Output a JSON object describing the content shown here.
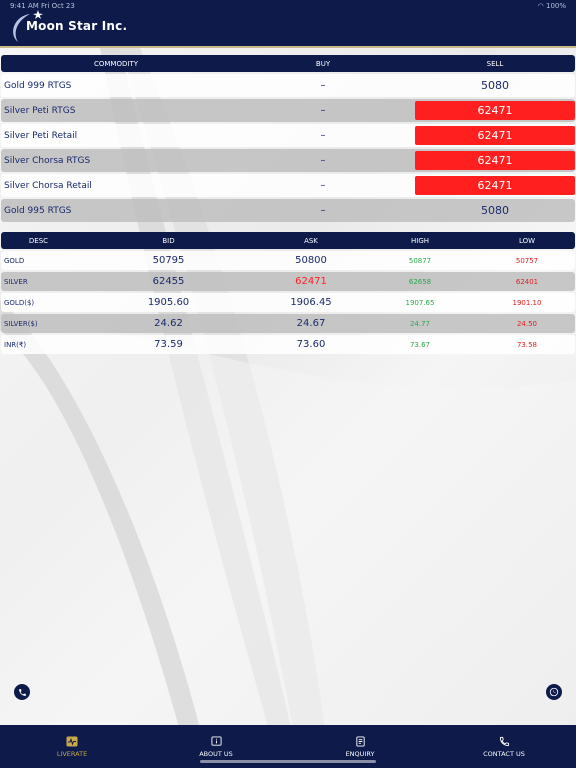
{
  "status": {
    "time": "9:41 AM",
    "date": "Fri Oct 23",
    "battery": "100%"
  },
  "brand": {
    "name": "Moon Star Inc."
  },
  "commodity_table": {
    "headers": {
      "commodity": "COMMODITY",
      "buy": "BUY",
      "sell": "SELL"
    },
    "rows": [
      {
        "name": "Gold 999 RTGS",
        "buy": "–",
        "sell": "5080",
        "highlight": false
      },
      {
        "name": "Silver Peti RTGS",
        "buy": "–",
        "sell": "62471",
        "highlight": true
      },
      {
        "name": "Silver Peti Retail",
        "buy": "–",
        "sell": "62471",
        "highlight": true
      },
      {
        "name": "Silver Chorsa RTGS",
        "buy": "–",
        "sell": "62471",
        "highlight": true
      },
      {
        "name": "Silver Chorsa Retail",
        "buy": "–",
        "sell": "62471",
        "highlight": true
      },
      {
        "name": "Gold 995 RTGS",
        "buy": "–",
        "sell": "5080",
        "highlight": false
      }
    ]
  },
  "rates_table": {
    "headers": {
      "desc": "DESC",
      "bid": "BID",
      "ask": "ASK",
      "high": "HIGH",
      "low": "LOW"
    },
    "rows": [
      {
        "desc": "GOLD",
        "bid": "50795",
        "ask": "50800",
        "high": "50877",
        "low": "50757",
        "ask_red": false
      },
      {
        "desc": "SILVER",
        "bid": "62455",
        "ask": "62471",
        "high": "62658",
        "low": "62401",
        "ask_red": true
      },
      {
        "desc": "GOLD($)",
        "bid": "1905.60",
        "ask": "1906.45",
        "high": "1907.65",
        "low": "1901.10",
        "ask_red": false
      },
      {
        "desc": "SILVER($)",
        "bid": "24.62",
        "ask": "24.67",
        "high": "24.77",
        "low": "24.50",
        "ask_red": false
      },
      {
        "desc": "INR(₹)",
        "bid": "73.59",
        "ask": "73.60",
        "high": "73.67",
        "low": "73.58",
        "ask_red": false
      }
    ]
  },
  "nav": {
    "items": [
      {
        "label": "LIVERATE",
        "icon": "liverate-icon",
        "active": true
      },
      {
        "label": "ABOUT US",
        "icon": "info-icon",
        "active": false
      },
      {
        "label": "ENQUIRY",
        "icon": "document-icon",
        "active": false
      },
      {
        "label": "CONTACT US",
        "icon": "phone-icon",
        "active": false
      }
    ]
  },
  "colors": {
    "navy": "#0d1a4a",
    "red": "#ff1f1f",
    "green": "#2aa84a",
    "gold": "#c9a84a"
  }
}
